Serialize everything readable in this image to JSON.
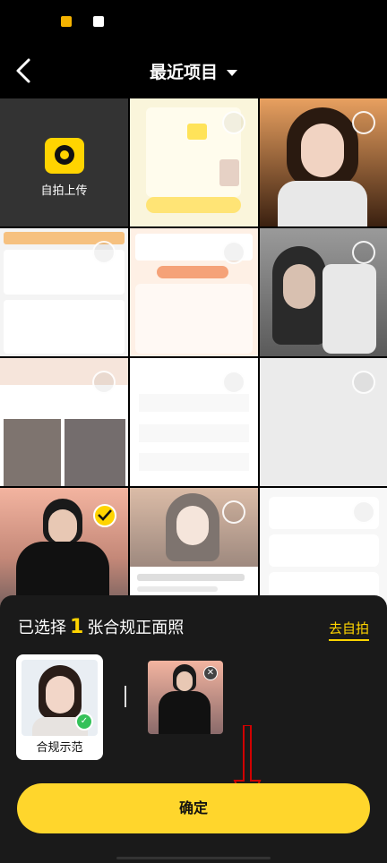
{
  "header": {
    "title": "最近项目"
  },
  "grid": {
    "upload_tile": {
      "label": "自拍上传"
    },
    "tiles": [
      {
        "name": "photo-upload-instructions",
        "selected": false
      },
      {
        "name": "photo-woman-portrait",
        "selected": false
      },
      {
        "name": "photo-app-profile-screen",
        "selected": false
      },
      {
        "name": "photo-app-tasks-screen",
        "selected": false
      },
      {
        "name": "photo-woman-phone",
        "selected": false
      },
      {
        "name": "photo-drama-posters",
        "selected": false
      },
      {
        "name": "photo-app-list-screen",
        "selected": false
      },
      {
        "name": "photo-gray-blank",
        "selected": false
      },
      {
        "name": "photo-man-hoodie",
        "selected": true
      },
      {
        "name": "photo-anime-girl",
        "selected": false
      },
      {
        "name": "photo-health-list",
        "selected": false
      }
    ]
  },
  "sheet": {
    "prefix": "已选择",
    "count": "1",
    "suffix": "张合规正面照",
    "selfie_link": "去自拍",
    "example_label": "合规示范",
    "confirm_label": "确定"
  },
  "colors": {
    "accent": "#ffd400",
    "confirm": "#ffd62c",
    "sheet_bg": "#1a1a1a",
    "arrow": "#d00000",
    "check_green": "#35c15a"
  }
}
